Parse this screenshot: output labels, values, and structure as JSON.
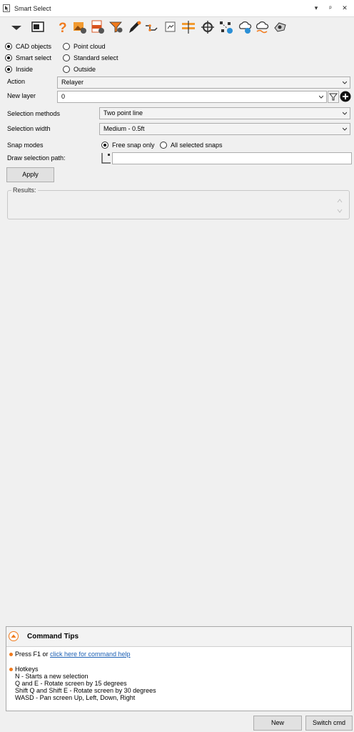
{
  "window": {
    "title": "Smart Select",
    "controls": [
      "▾",
      "ᵖ",
      "✕"
    ]
  },
  "toolbar": {
    "icons": [
      "dropdown-arrow-icon",
      "screen-icon",
      "help-icon",
      "image-settings-icon",
      "pdf-settings-icon",
      "funnel-settings-icon",
      "pen-icon",
      "polyline-icon",
      "scan-icon",
      "ruler-layers-icon",
      "target-icon",
      "selection-points-icon",
      "cloud-add-icon",
      "cloud-add-2-icon",
      "cloud-settings-icon",
      "view-icon"
    ]
  },
  "mode_row1": {
    "opt1": "CAD objects",
    "opt2": "Point cloud",
    "selected": "CAD objects"
  },
  "mode_row2": {
    "opt1": "Smart select",
    "opt2": "Standard select",
    "selected": "Smart select"
  },
  "mode_row3": {
    "opt1": "Inside",
    "opt2": "Outside",
    "selected": "Inside"
  },
  "action": {
    "label": "Action",
    "value": "Relayer"
  },
  "new_layer": {
    "label": "New layer",
    "value": "0"
  },
  "selection_methods": {
    "label": "Selection methods",
    "value": "Two point line"
  },
  "selection_width": {
    "label": "Selection width",
    "value": "Medium - 0.5ft"
  },
  "snap_modes": {
    "label": "Snap modes",
    "opt1": "Free snap only",
    "opt2": "All selected snaps",
    "selected": "Free snap only"
  },
  "draw_path": {
    "label": "Draw selection path:",
    "value": ""
  },
  "apply_label": "Apply",
  "results_label": "Results:",
  "command_tips": {
    "title": "Command Tips",
    "tip1_prefix": "Press F1 or ",
    "tip1_link": "click here for command help",
    "hotkeys_title": "Hotkeys",
    "hotkeys": [
      "N - Starts a new selection",
      "Q and E - Rotate screen by 15 degrees",
      "Shift Q and Shift E - Rotate screen by 30 degrees",
      "WASD - Pan screen Up, Left, Down, Right"
    ]
  },
  "buttons": {
    "new": "New",
    "switch": "Switch cmd"
  },
  "colors": {
    "accent_orange": "#f07a1c",
    "link_blue": "#1a5fb4"
  }
}
